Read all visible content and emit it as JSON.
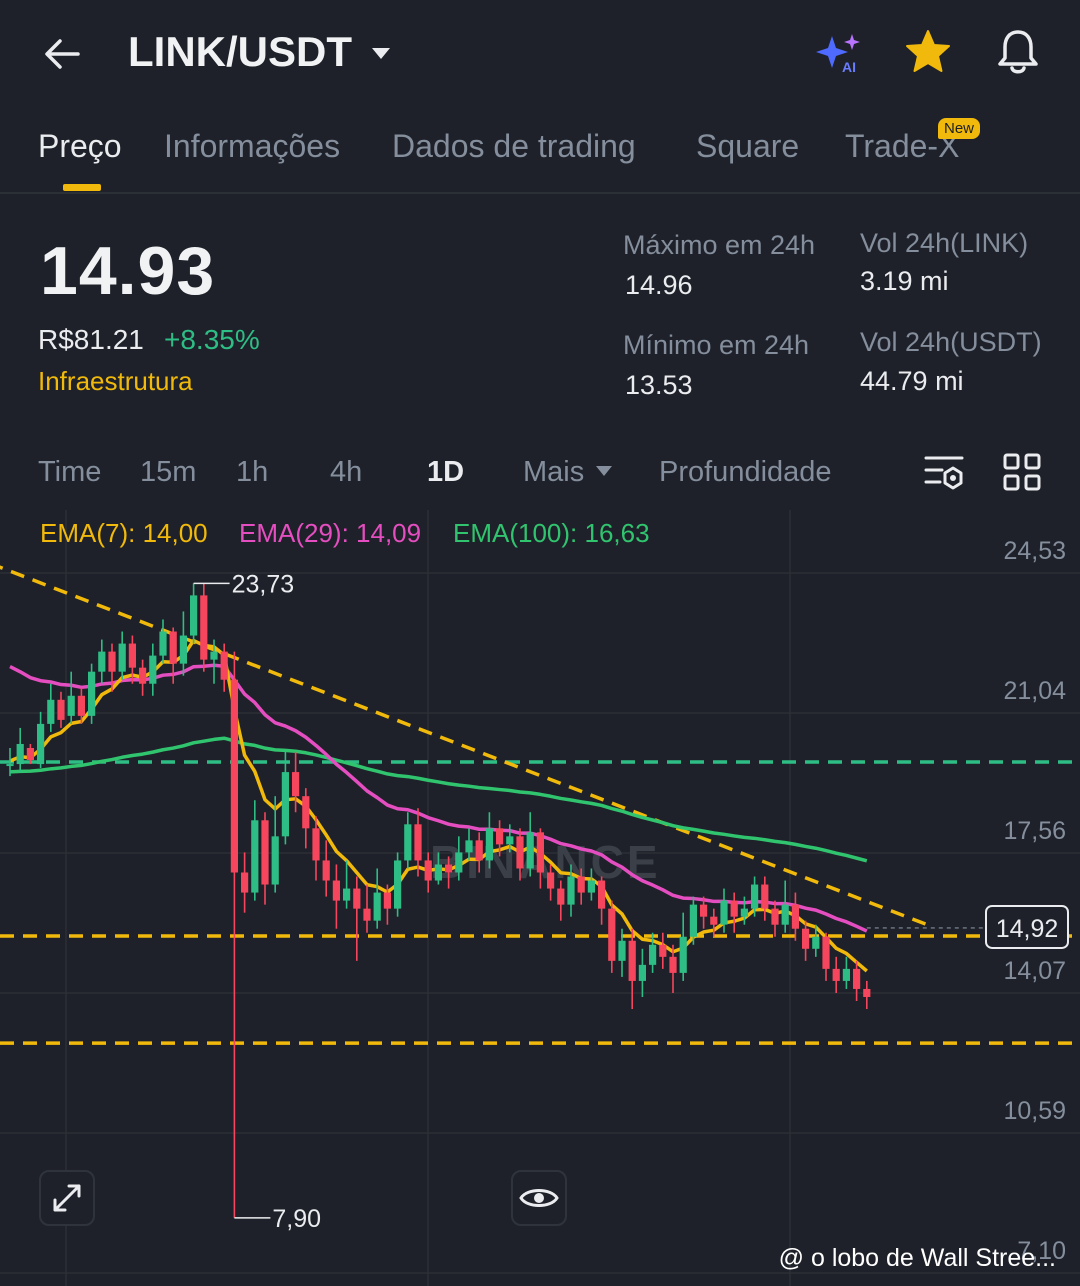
{
  "header": {
    "pair": "LINK/USDT",
    "icons": [
      "back-arrow-icon",
      "caret-down-icon",
      "ai-sparkle-icon",
      "star-icon",
      "bell-icon"
    ],
    "ai_label": "AI"
  },
  "tabs": [
    {
      "label": "Preço",
      "active": true
    },
    {
      "label": "Informações",
      "active": false
    },
    {
      "label": "Dados de trading",
      "active": false
    },
    {
      "label": "Square",
      "active": false
    },
    {
      "label": "Trade-X",
      "active": false
    }
  ],
  "new_badge": "New",
  "price": {
    "last": "14.93",
    "fiat": "R$81.21",
    "change": "+8.35%",
    "sector": "Infraestrutura"
  },
  "stats": {
    "high_label": "Máximo em 24h",
    "high_value": "14.96",
    "low_label": "Mínimo em 24h",
    "low_value": "13.53",
    "vol_base_label": "Vol 24h(LINK)",
    "vol_base_value": "3.19 mi",
    "vol_quote_label": "Vol 24h(USDT)",
    "vol_quote_value": "44.79 mi"
  },
  "timeframes": [
    "Time",
    "15m",
    "1h",
    "4h",
    "1D",
    "Mais",
    "Profundidade"
  ],
  "active_timeframe": "1D",
  "ema": {
    "ema7": "EMA(7): 14,00",
    "ema29": "EMA(29): 14,09",
    "ema100": "EMA(100): 16,63"
  },
  "colors": {
    "background": "#1e2129",
    "up": "#2ebd85",
    "down": "#f6465d",
    "accent": "#f0b90b",
    "ema7": "#f0b90b",
    "ema29": "#e54ec0",
    "ema100": "#31c46f",
    "muted": "#848e9c"
  },
  "chart_data": {
    "type": "candlestick",
    "y_ticks": [
      "24,53",
      "21,04",
      "17,56",
      "14,07",
      "10,59",
      "7,10"
    ],
    "ylim": [
      7.1,
      24.53
    ],
    "annotations": {
      "high": "23,73",
      "low": "7,90"
    },
    "last_price_label": "14,92",
    "last_price": 14.92,
    "horizontal_lines": [
      {
        "value": 19.25,
        "color": "#2ebd85"
      },
      {
        "value": 14.92,
        "color": "#f0b90b"
      },
      {
        "value": 12.25,
        "color": "#f0b90b"
      }
    ],
    "trendline": [
      [
        -2,
        24.2
      ],
      [
        86,
        15.2
      ]
    ],
    "candles": [
      [
        19.2,
        19.2,
        19.6,
        18.9
      ],
      [
        19.2,
        19.7,
        20.1,
        19.0
      ],
      [
        19.6,
        19.3,
        19.7,
        19.2
      ],
      [
        19.2,
        20.2,
        20.5,
        19.1
      ],
      [
        20.2,
        20.8,
        21.2,
        20.0
      ],
      [
        20.8,
        20.3,
        21.0,
        20.1
      ],
      [
        20.4,
        20.9,
        21.5,
        20.2
      ],
      [
        20.9,
        20.4,
        21.1,
        20.2
      ],
      [
        20.4,
        21.5,
        21.7,
        20.2
      ],
      [
        21.5,
        22.0,
        22.3,
        21.2
      ],
      [
        22.0,
        21.5,
        22.2,
        21.0
      ],
      [
        21.5,
        22.2,
        22.5,
        21.3
      ],
      [
        22.2,
        21.6,
        22.4,
        21.2
      ],
      [
        21.6,
        21.2,
        21.8,
        20.9
      ],
      [
        21.2,
        21.9,
        22.2,
        20.9
      ],
      [
        21.9,
        22.5,
        22.8,
        21.7
      ],
      [
        22.5,
        21.7,
        22.6,
        21.2
      ],
      [
        21.7,
        22.4,
        23.0,
        21.4
      ],
      [
        22.4,
        23.4,
        23.7,
        22.2
      ],
      [
        23.4,
        21.8,
        23.7,
        21.5
      ],
      [
        21.8,
        22.0,
        22.3,
        21.2
      ],
      [
        22.0,
        21.3,
        22.2,
        21.0
      ],
      [
        21.3,
        16.5,
        22.0,
        7.9
      ],
      [
        16.5,
        16.0,
        17.0,
        15.5
      ],
      [
        16.0,
        17.8,
        18.3,
        15.8
      ],
      [
        17.8,
        16.2,
        18.0,
        15.7
      ],
      [
        16.2,
        17.4,
        18.4,
        16.0
      ],
      [
        17.4,
        19.0,
        19.5,
        17.2
      ],
      [
        19.0,
        18.4,
        19.5,
        18.0
      ],
      [
        18.4,
        17.6,
        18.6,
        17.1
      ],
      [
        17.6,
        16.8,
        17.9,
        16.3
      ],
      [
        16.8,
        16.3,
        17.3,
        15.9
      ],
      [
        16.3,
        15.8,
        16.7,
        15.1
      ],
      [
        15.8,
        16.1,
        16.8,
        15.6
      ],
      [
        16.1,
        15.6,
        16.4,
        14.3
      ],
      [
        15.6,
        15.3,
        16.2,
        15.0
      ],
      [
        15.3,
        16.0,
        16.6,
        15.1
      ],
      [
        16.0,
        15.6,
        16.2,
        15.2
      ],
      [
        15.6,
        16.8,
        17.0,
        15.4
      ],
      [
        16.8,
        17.7,
        18.0,
        16.6
      ],
      [
        17.7,
        16.8,
        18.1,
        16.4
      ],
      [
        16.8,
        16.3,
        17.0,
        16.0
      ],
      [
        16.3,
        16.7,
        17.0,
        16.2
      ],
      [
        16.7,
        16.5,
        16.9,
        16.1
      ],
      [
        16.5,
        17.0,
        17.4,
        16.3
      ],
      [
        17.0,
        17.3,
        17.6,
        16.8
      ],
      [
        17.3,
        16.8,
        17.5,
        16.5
      ],
      [
        16.8,
        17.6,
        18.0,
        16.6
      ],
      [
        17.6,
        17.2,
        17.8,
        16.9
      ],
      [
        17.2,
        17.4,
        17.7,
        17.0
      ],
      [
        17.4,
        16.6,
        17.6,
        16.3
      ],
      [
        16.6,
        17.5,
        18.0,
        16.4
      ],
      [
        17.5,
        16.5,
        17.6,
        16.1
      ],
      [
        16.5,
        16.1,
        16.7,
        15.8
      ],
      [
        16.1,
        15.7,
        16.3,
        15.3
      ],
      [
        15.7,
        16.4,
        16.7,
        15.4
      ],
      [
        16.4,
        16.0,
        16.6,
        15.7
      ],
      [
        16.0,
        16.3,
        16.6,
        15.8
      ],
      [
        16.3,
        15.6,
        16.4,
        15.2
      ],
      [
        15.6,
        14.3,
        15.8,
        14.0
      ],
      [
        14.3,
        14.8,
        15.1,
        13.9
      ],
      [
        14.8,
        13.8,
        15.1,
        13.1
      ],
      [
        13.8,
        14.2,
        14.6,
        13.4
      ],
      [
        14.2,
        14.7,
        15.0,
        14.0
      ],
      [
        14.7,
        14.4,
        15.0,
        14.1
      ],
      [
        14.4,
        14.0,
        14.7,
        13.5
      ],
      [
        14.0,
        14.9,
        15.5,
        13.8
      ],
      [
        14.9,
        15.7,
        15.9,
        14.7
      ],
      [
        15.7,
        15.4,
        15.9,
        15.1
      ],
      [
        15.4,
        15.2,
        15.6,
        14.9
      ],
      [
        15.2,
        15.8,
        16.1,
        15.0
      ],
      [
        15.8,
        15.4,
        16.0,
        15.0
      ],
      [
        15.4,
        15.6,
        15.9,
        15.2
      ],
      [
        15.6,
        16.2,
        16.4,
        15.4
      ],
      [
        16.2,
        15.6,
        16.4,
        15.3
      ],
      [
        15.6,
        15.2,
        15.8,
        14.9
      ],
      [
        15.2,
        15.7,
        16.3,
        15.0
      ],
      [
        15.7,
        15.1,
        16.0,
        14.8
      ],
      [
        15.1,
        14.6,
        15.3,
        14.3
      ],
      [
        14.6,
        14.9,
        15.2,
        14.4
      ],
      [
        14.9,
        14.1,
        15.0,
        13.8
      ],
      [
        14.1,
        13.8,
        14.4,
        13.5
      ],
      [
        13.8,
        14.1,
        14.4,
        13.6
      ],
      [
        14.1,
        13.6,
        14.3,
        13.3
      ],
      [
        13.6,
        13.4,
        13.8,
        13.1
      ]
    ]
  },
  "watermark": "BINANCE",
  "credit": "@ o lobo de Wall Stree..."
}
